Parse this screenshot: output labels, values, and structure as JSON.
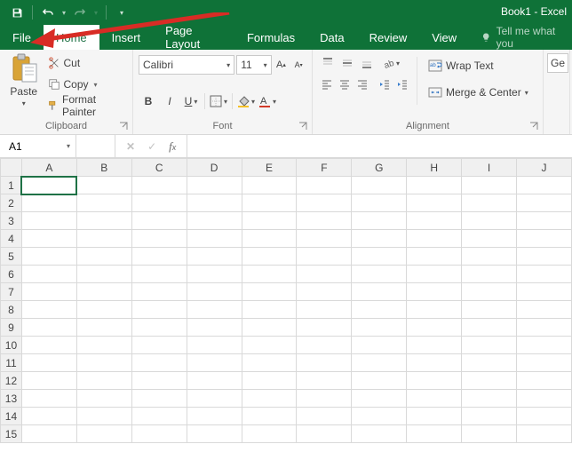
{
  "titlebar": {
    "title": "Book1 - Excel"
  },
  "tabs": {
    "file": "File",
    "home": "Home",
    "insert": "Insert",
    "pageLayout": "Page Layout",
    "formulas": "Formulas",
    "data": "Data",
    "review": "Review",
    "view": "View",
    "tellme": "Tell me what you"
  },
  "ribbon": {
    "clipboard": {
      "paste": "Paste",
      "cut": "Cut",
      "copy": "Copy",
      "formatPainter": "Format Painter",
      "label": "Clipboard"
    },
    "font": {
      "name": "Calibri",
      "size": "11",
      "label": "Font"
    },
    "alignment": {
      "wrap": "Wrap Text",
      "merge": "Merge & Center",
      "label": "Alignment"
    },
    "editing": {
      "partial": "Ge"
    }
  },
  "formulaBar": {
    "namebox": "A1",
    "value": ""
  },
  "grid": {
    "cols": [
      "A",
      "B",
      "C",
      "D",
      "E",
      "F",
      "G",
      "H",
      "I",
      "J"
    ],
    "rows": [
      "1",
      "2",
      "3",
      "4",
      "5",
      "6",
      "7",
      "8",
      "9",
      "10",
      "11",
      "12",
      "13",
      "14",
      "15"
    ]
  }
}
